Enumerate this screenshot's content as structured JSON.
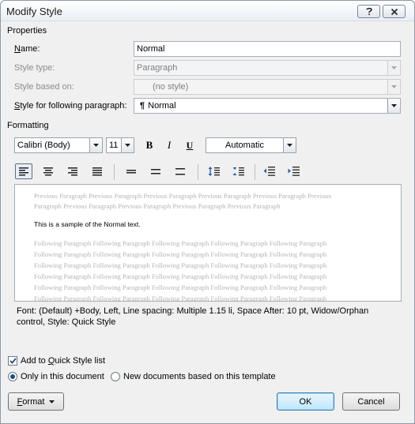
{
  "window": {
    "title": "Modify Style"
  },
  "properties": {
    "heading": "Properties",
    "name_label": "Name:",
    "name_value": "Normal",
    "style_type_label": "Style type:",
    "style_type_value": "Paragraph",
    "based_on_label": "Style based on:",
    "based_on_value": "(no style)",
    "following_label": "Style for following paragraph:",
    "following_value": "Normal",
    "following_icon": "pilcrow-icon"
  },
  "formatting": {
    "heading": "Formatting",
    "font_value": "Calibri (Body)",
    "size_value": "11",
    "bold": "B",
    "italic": "I",
    "underline": "U",
    "color_value": "Automatic",
    "active_alignment": "align-left"
  },
  "preview": {
    "previous_lines": [
      "Previous Paragraph Previous Paragraph Previous Paragraph Previous Paragraph Previous Paragraph Previous",
      "Paragraph Previous Paragraph Previous Paragraph Previous Paragraph Previous Paragraph"
    ],
    "sample": "This is a sample of the Normal text.",
    "following_lines": [
      "Following Paragraph Following Paragraph Following Paragraph Following Paragraph Following Paragraph",
      "Following Paragraph Following Paragraph Following Paragraph Following Paragraph Following Paragraph",
      "Following Paragraph Following Paragraph Following Paragraph Following Paragraph Following Paragraph",
      "Following Paragraph Following Paragraph Following Paragraph Following Paragraph Following Paragraph",
      "Following Paragraph Following Paragraph Following Paragraph Following Paragraph Following Paragraph",
      "Following Paragraph Following Paragraph Following Paragraph Following Paragraph Following Paragraph"
    ]
  },
  "description": {
    "line1": "Font: (Default) +Body, Left, Line spacing:  Multiple 1.15 li, Space After:  10 pt, Widow/Orphan",
    "line2": "control, Style: Quick Style"
  },
  "options": {
    "add_quick_style": "Add to Quick Style list",
    "add_quick_style_checked": true,
    "only_this_doc": "Only in this document",
    "new_docs": "New documents based on this template",
    "selected": "only_this_doc"
  },
  "buttons": {
    "format": "Format",
    "ok": "OK",
    "cancel": "Cancel"
  },
  "colors": {
    "accent": "#3c7fb1",
    "disabled_text": "#8c8c8c",
    "preview_gray": "#b5b5b5"
  }
}
